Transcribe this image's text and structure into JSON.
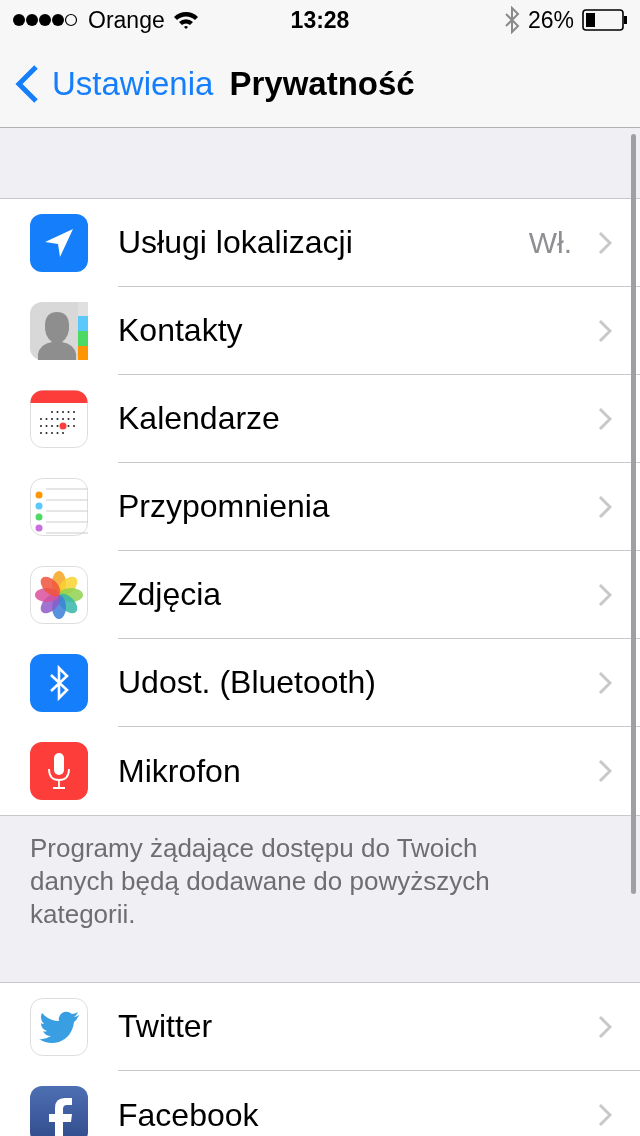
{
  "status_bar": {
    "carrier": "Orange",
    "time": "13:28",
    "battery": "26%"
  },
  "nav": {
    "back": "Ustawienia",
    "title": "Prywatność"
  },
  "groups": [
    {
      "items": [
        {
          "kind": "location",
          "label": "Usługi lokalizacji",
          "value": "Wł."
        },
        {
          "kind": "contacts",
          "label": "Kontakty"
        },
        {
          "kind": "calendar",
          "label": "Kalendarze"
        },
        {
          "kind": "reminders",
          "label": "Przypomnienia"
        },
        {
          "kind": "photos",
          "label": "Zdjęcia"
        },
        {
          "kind": "bluetooth",
          "label": "Udost. (Bluetooth)"
        },
        {
          "kind": "microphone",
          "label": "Mikrofon"
        }
      ],
      "footer": "Programy żądające dostępu do Twoich danych będą dodawane do powyższych kategorii."
    },
    {
      "items": [
        {
          "kind": "twitter",
          "label": "Twitter"
        },
        {
          "kind": "facebook",
          "label": "Facebook"
        }
      ]
    }
  ]
}
